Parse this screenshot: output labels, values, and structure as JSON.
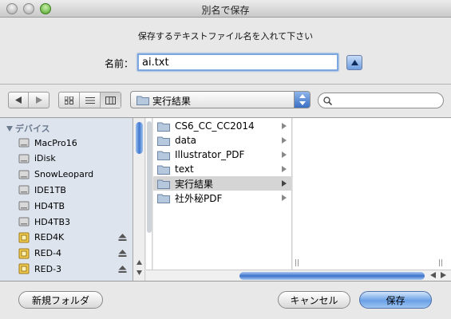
{
  "window": {
    "title": "別名で保存"
  },
  "prompt": "保存するテキストファイル名を入れて下さい",
  "name_field": {
    "label": "名前：",
    "value": "ai.txt"
  },
  "location_popup": {
    "selected": "実行結果"
  },
  "sidebar": {
    "heading": "デバイス",
    "items": [
      {
        "label": "MacPro16",
        "eject": false
      },
      {
        "label": "iDisk",
        "eject": false
      },
      {
        "label": "SnowLeopard",
        "eject": false
      },
      {
        "label": "IDE1TB",
        "eject": false
      },
      {
        "label": "HD4TB",
        "eject": false
      },
      {
        "label": "HD4TB3",
        "eject": false
      },
      {
        "label": "RED4K",
        "eject": true
      },
      {
        "label": "RED-4",
        "eject": true
      },
      {
        "label": "RED-3",
        "eject": true
      }
    ]
  },
  "column": {
    "items": [
      {
        "label": "CS6_CC_CC2014",
        "selected": false
      },
      {
        "label": "data",
        "selected": false
      },
      {
        "label": "Illustrator_PDF",
        "selected": false
      },
      {
        "label": "text",
        "selected": false
      },
      {
        "label": "実行結果",
        "selected": true
      },
      {
        "label": "社外秘PDF",
        "selected": false
      }
    ]
  },
  "buttons": {
    "new_folder": "新規フォルダ",
    "cancel": "キャンセル",
    "save": "保存"
  },
  "colors": {
    "accent": "#3f78cf",
    "sidebar_bg": "#dde4ee",
    "selection": "#d5d5d5"
  }
}
